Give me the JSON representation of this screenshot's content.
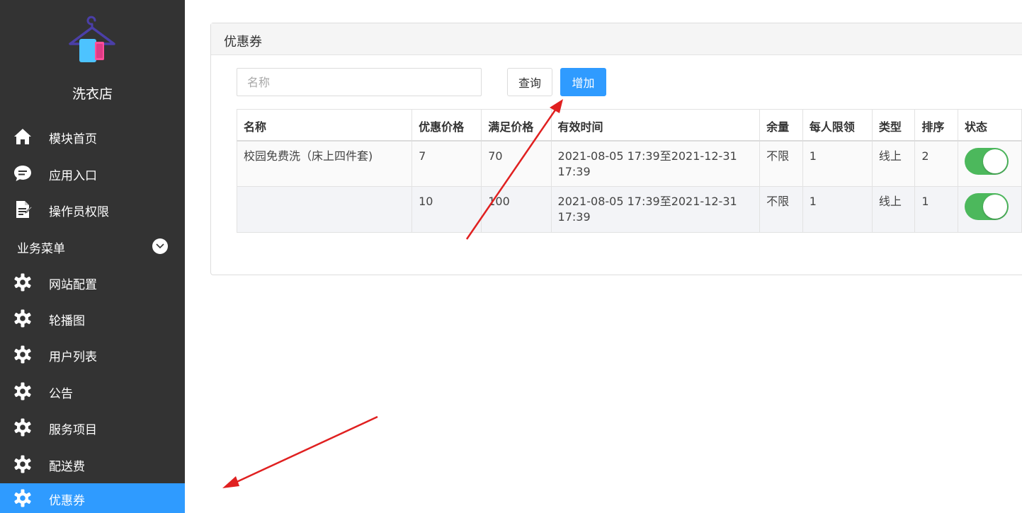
{
  "sidebar": {
    "brand": "洗衣店",
    "items_top": [
      {
        "label": "模块首页",
        "icon": "home-icon"
      },
      {
        "label": "应用入口",
        "icon": "chat-icon"
      },
      {
        "label": "操作员权限",
        "icon": "document-icon"
      }
    ],
    "group": {
      "label": "业务菜单",
      "icon": "chevron-down-icon"
    },
    "items_biz": [
      {
        "label": "网站配置",
        "icon": "gear-icon"
      },
      {
        "label": "轮播图",
        "icon": "gear-icon"
      },
      {
        "label": "用户列表",
        "icon": "gear-icon"
      },
      {
        "label": "公告",
        "icon": "gear-icon"
      },
      {
        "label": "服务项目",
        "icon": "gear-icon"
      },
      {
        "label": "配送费",
        "icon": "gear-icon"
      },
      {
        "label": "优惠券",
        "icon": "gear-icon",
        "active": true
      }
    ]
  },
  "panel": {
    "title": "优惠券",
    "search": {
      "placeholder": "名称",
      "value": ""
    },
    "query_label": "查询",
    "add_label": "增加"
  },
  "table": {
    "headers": [
      "名称",
      "优惠价格",
      "满足价格",
      "有效时间",
      "余量",
      "每人限领",
      "类型",
      "排序",
      "状态"
    ],
    "rows": [
      {
        "name": "校园免费洗（床上四件套)",
        "discount": "7",
        "threshold": "70",
        "valid": "2021-08-05 17:39至2021-12-31 17:39",
        "remaining": "不限",
        "limit": "1",
        "type": "线上",
        "sort": "2",
        "status_on": true
      },
      {
        "name": "",
        "discount": "10",
        "threshold": "100",
        "valid": "2021-08-05 17:39至2021-12-31 17:39",
        "remaining": "不限",
        "limit": "1",
        "type": "线上",
        "sort": "1",
        "status_on": true
      }
    ]
  },
  "colors": {
    "sidebar_bg": "#333333",
    "accent": "#2f9bff",
    "toggle_on": "#4cb85c",
    "annotation_arrow": "#e02020"
  }
}
